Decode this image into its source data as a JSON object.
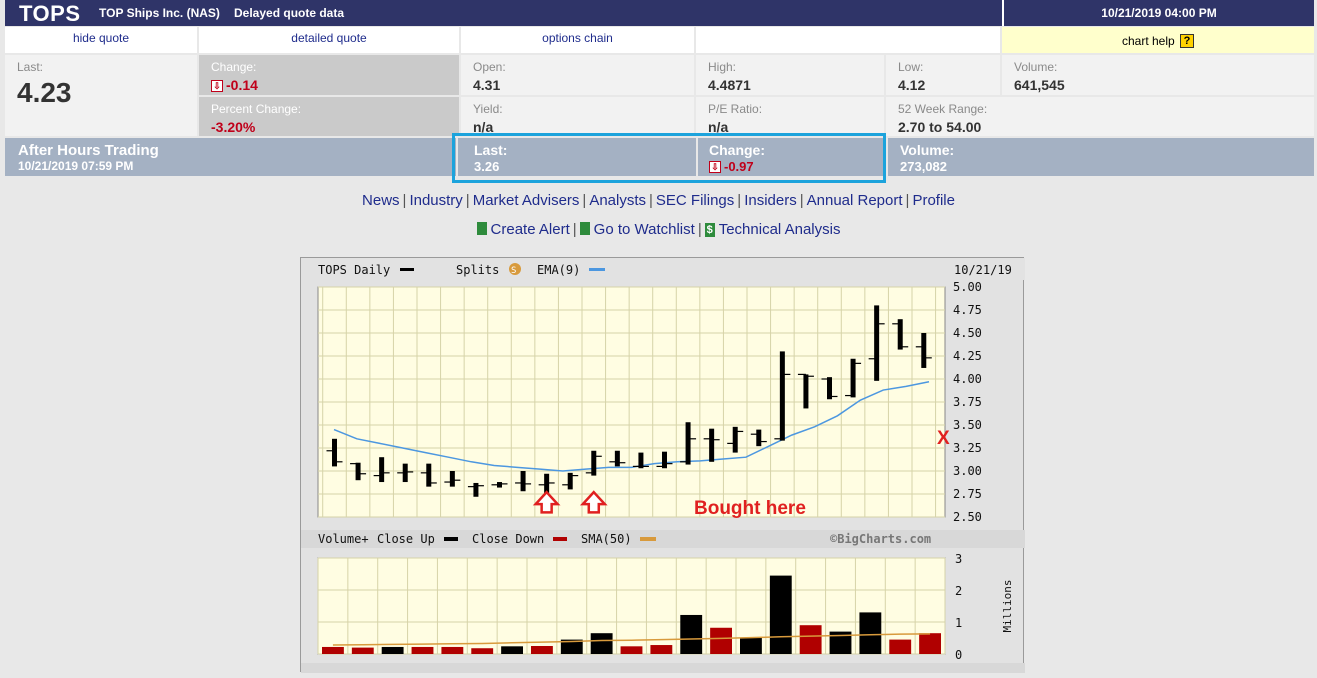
{
  "header": {
    "ticker": "TOPS",
    "company": "TOP Ships Inc. (NAS)",
    "delayed": "Delayed quote data",
    "datetime": "10/21/2019 04:00 PM"
  },
  "nav": {
    "hide_quote": "hide quote",
    "detailed_quote": "detailed quote",
    "options_chain": "options chain",
    "chart_help": "chart help",
    "help_icon": "?"
  },
  "quote": {
    "last_label": "Last:",
    "last": "4.23",
    "change_label": "Change:",
    "change": "-0.14",
    "pct_change_label": "Percent Change:",
    "pct_change": "-3.20%",
    "open_label": "Open:",
    "open": "4.31",
    "yield_label": "Yield:",
    "yield": "n/a",
    "high_label": "High:",
    "high": "4.4871",
    "pe_label": "P/E Ratio:",
    "pe": "n/a",
    "low_label": "Low:",
    "low": "4.12",
    "range_label": "52 Week Range:",
    "range": "2.70 to 54.00",
    "volume_label": "Volume:",
    "volume": "641,545",
    "down_icon": "down-arrow-icon"
  },
  "after_hours": {
    "title": "After Hours Trading",
    "time": "10/21/2019 07:59 PM",
    "last_label": "Last:",
    "last": "3.26",
    "change_label": "Change:",
    "change": "-0.97",
    "volume_label": "Volume:",
    "volume": "273,082"
  },
  "links_row1": [
    "News",
    "Industry",
    "Market Advisers",
    "Analysts",
    "SEC Filings",
    "Insiders",
    "Annual Report",
    "Profile"
  ],
  "links_row2": {
    "create_alert": "Create Alert",
    "watchlist": "Go to Watchlist",
    "technical": "Technical Analysis",
    "dollar": "$"
  },
  "chart_data": {
    "type": "ohlc",
    "header_left": "TOPS Daily",
    "splits_label": "Splits",
    "ema_label": "EMA(9)",
    "date": "10/21/19",
    "ylim": [
      2.5,
      5.0
    ],
    "y_ticks": [
      "5.00",
      "4.75",
      "4.50",
      "4.25",
      "4.00",
      "3.75",
      "3.50",
      "3.25",
      "3.00",
      "2.75",
      "2.50"
    ],
    "bars": [
      {
        "o": 3.22,
        "h": 3.35,
        "l": 3.05,
        "c": 3.1
      },
      {
        "o": 3.08,
        "h": 3.09,
        "l": 2.9,
        "c": 2.97
      },
      {
        "o": 2.95,
        "h": 3.15,
        "l": 2.88,
        "c": 2.98
      },
      {
        "o": 2.98,
        "h": 3.08,
        "l": 2.88,
        "c": 2.99
      },
      {
        "o": 2.98,
        "h": 3.08,
        "l": 2.83,
        "c": 2.87
      },
      {
        "o": 2.88,
        "h": 3.0,
        "l": 2.83,
        "c": 2.9
      },
      {
        "o": 2.83,
        "h": 2.87,
        "l": 2.72,
        "c": 2.84
      },
      {
        "o": 2.85,
        "h": 2.88,
        "l": 2.82,
        "c": 2.86
      },
      {
        "o": 2.87,
        "h": 3.0,
        "l": 2.78,
        "c": 2.86
      },
      {
        "o": 2.85,
        "h": 2.97,
        "l": 2.73,
        "c": 2.87
      },
      {
        "o": 2.85,
        "h": 2.98,
        "l": 2.8,
        "c": 2.95
      },
      {
        "o": 2.98,
        "h": 3.22,
        "l": 2.95,
        "c": 3.16
      },
      {
        "o": 3.1,
        "h": 3.22,
        "l": 3.05,
        "c": 3.09
      },
      {
        "o": 3.05,
        "h": 3.2,
        "l": 3.03,
        "c": 3.05
      },
      {
        "o": 3.05,
        "h": 3.21,
        "l": 3.03,
        "c": 3.08
      },
      {
        "o": 3.1,
        "h": 3.53,
        "l": 3.07,
        "c": 3.35
      },
      {
        "o": 3.35,
        "h": 3.46,
        "l": 3.1,
        "c": 3.34
      },
      {
        "o": 3.3,
        "h": 3.48,
        "l": 3.2,
        "c": 3.43
      },
      {
        "o": 3.4,
        "h": 3.45,
        "l": 3.27,
        "c": 3.32
      },
      {
        "o": 3.35,
        "h": 4.3,
        "l": 3.33,
        "c": 4.05
      },
      {
        "o": 4.05,
        "h": 4.05,
        "l": 3.68,
        "c": 4.03
      },
      {
        "o": 4.0,
        "h": 4.02,
        "l": 3.78,
        "c": 3.81
      },
      {
        "o": 3.82,
        "h": 4.22,
        "l": 3.8,
        "c": 4.17
      },
      {
        "o": 4.22,
        "h": 4.8,
        "l": 3.98,
        "c": 4.6
      },
      {
        "o": 4.6,
        "h": 4.65,
        "l": 4.32,
        "c": 4.35
      },
      {
        "o": 4.35,
        "h": 4.5,
        "l": 4.12,
        "c": 4.23
      }
    ],
    "ema": [
      3.45,
      3.35,
      3.3,
      3.25,
      3.2,
      3.15,
      3.1,
      3.06,
      3.04,
      3.02,
      3.0,
      3.02,
      3.04,
      3.04,
      3.08,
      3.1,
      3.11,
      3.13,
      3.15,
      3.27,
      3.39,
      3.48,
      3.6,
      3.77,
      3.88,
      3.92,
      3.97
    ],
    "annotation": "Bought here",
    "x_mark": "X",
    "volume_legend": {
      "volume_plus": "Volume+",
      "close_up": "Close Up",
      "close_down": "Close Down",
      "sma": "SMA(50)",
      "copyright": "©BigCharts.com"
    },
    "volume_ylim": [
      0,
      3
    ],
    "volume_ticks": [
      "3",
      "2",
      "1",
      "0"
    ],
    "volume_unit": "Millions",
    "volume": [
      {
        "v": 0.22,
        "up": false
      },
      {
        "v": 0.2,
        "up": false
      },
      {
        "v": 0.22,
        "up": true
      },
      {
        "v": 0.22,
        "up": false
      },
      {
        "v": 0.22,
        "up": false
      },
      {
        "v": 0.18,
        "up": false
      },
      {
        "v": 0.24,
        "up": true
      },
      {
        "v": 0.25,
        "up": false
      },
      {
        "v": 0.45,
        "up": true
      },
      {
        "v": 0.65,
        "up": true
      },
      {
        "v": 0.24,
        "up": false
      },
      {
        "v": 0.28,
        "up": false
      },
      {
        "v": 1.22,
        "up": true
      },
      {
        "v": 0.82,
        "up": false
      },
      {
        "v": 0.5,
        "up": true
      },
      {
        "v": 2.45,
        "up": true
      },
      {
        "v": 0.9,
        "up": false
      },
      {
        "v": 0.7,
        "up": true
      },
      {
        "v": 1.3,
        "up": true
      },
      {
        "v": 0.45,
        "up": false
      },
      {
        "v": 0.65,
        "up": false
      }
    ],
    "volume_sma": [
      0.28,
      0.29,
      0.3,
      0.31,
      0.32,
      0.33,
      0.35,
      0.37,
      0.39,
      0.42,
      0.43,
      0.45,
      0.47,
      0.49,
      0.51,
      0.54,
      0.56,
      0.58,
      0.6,
      0.62,
      0.63
    ],
    "colors": {
      "up": "#000000",
      "down": "#b00000",
      "ema": "#4c97e0",
      "sma": "#d89a3c",
      "grid_bg": "#fffde2",
      "annotation": "#e02020"
    }
  }
}
